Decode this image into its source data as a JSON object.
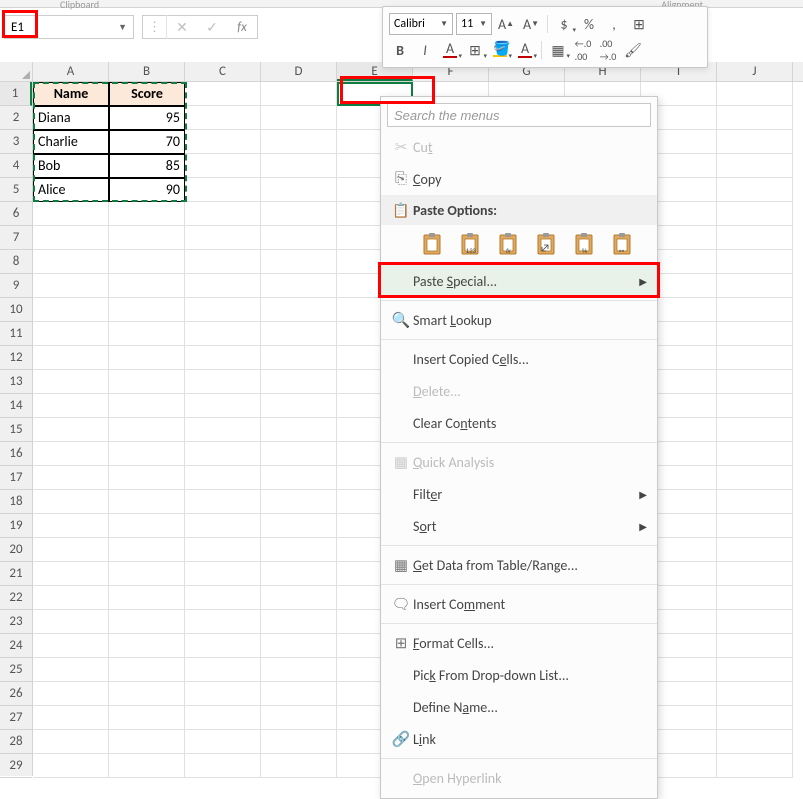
{
  "ribbon": {
    "clipboard_label": "Clipboard",
    "alignment_label": "Alignment"
  },
  "name_box": {
    "value": "E1"
  },
  "float_toolbar": {
    "font_name": "Calibri",
    "font_size": "11",
    "bold": "B",
    "italic": "I",
    "inc_a": "A",
    "dec_a": "A",
    "dollar": "$",
    "percent": "%",
    "comma": ",",
    "underline": "A",
    "fill": "◆",
    "font_color": "A",
    "inc_dec": ".0",
    "dec_dec": ".00"
  },
  "columns": [
    "A",
    "B",
    "C",
    "D",
    "E",
    "F",
    "G",
    "H",
    "I",
    "J"
  ],
  "rows": [
    "1",
    "2",
    "3",
    "4",
    "5",
    "6",
    "7",
    "8",
    "9",
    "10",
    "11",
    "12",
    "13",
    "14",
    "15",
    "16",
    "17",
    "18",
    "19",
    "20",
    "21",
    "22",
    "23",
    "24",
    "25",
    "26",
    "27",
    "28",
    "29"
  ],
  "table": {
    "headers": [
      "Name",
      "Score"
    ],
    "data": [
      [
        "Diana",
        "95"
      ],
      [
        "Charlie",
        "70"
      ],
      [
        "Bob",
        "85"
      ],
      [
        "Alice",
        "90"
      ]
    ]
  },
  "ctx": {
    "search_placeholder": "Search the menus",
    "cut": "Cut",
    "copy": "Copy",
    "paste_options": "Paste Options:",
    "paste_special": "Paste Special...",
    "smart_lookup": "Smart Lookup",
    "insert_copied": "Insert Copied Cells...",
    "delete": "Delete...",
    "clear_contents": "Clear Contents",
    "quick_analysis": "Quick Analysis",
    "filter": "Filter",
    "sort": "Sort",
    "get_data": "Get Data from Table/Range...",
    "insert_comment": "Insert Comment",
    "format_cells": "Format Cells...",
    "pick_list": "Pick From Drop-down List...",
    "define_name": "Define Name...",
    "link": "Link",
    "open_hyperlink": "Open Hyperlink",
    "paste_sub": {
      "values": "123",
      "fx": "fx",
      "transpose": "⤢",
      "percent": "%",
      "link": "⚯"
    }
  }
}
